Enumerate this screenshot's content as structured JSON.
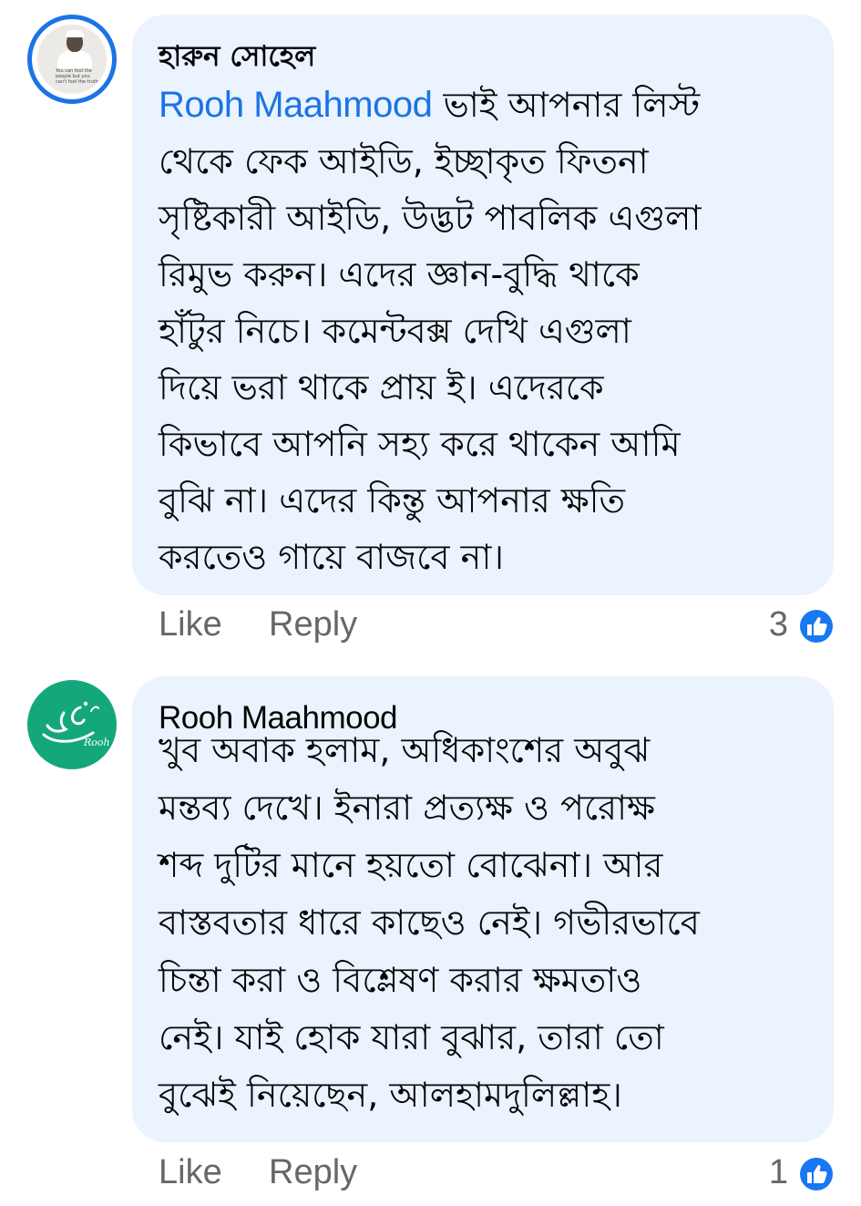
{
  "colors": {
    "bubble_bg": "#eaf3fe",
    "mention": "#1b74e4",
    "action_text": "#65676b",
    "like_badge": "#1877f2",
    "avatar2_bg": "#15a77c"
  },
  "comments": [
    {
      "author": "হারুন সোহেল",
      "avatar_icon": "profile-photo-icon",
      "avatar_text": "You can fool the people but you can't fool the truth",
      "mention": "Rooh Maahmood",
      "text": " ভাই আপনার লিস্ট\nথেকে ফেক আইডি, ইচ্ছাকৃত ফিতনা\nসৃষ্টিকারী আইডি, উদ্ভট পাবলিক এগুলা\nরিমুভ করুন। এদের জ্ঞান-বুদ্ধি থাকে\nহাঁটুর নিচে। কমেন্টবক্স দেখি এগুলা\nদিয়ে ভরা থাকে প্রায় ই। এদেরকে\nকিভাবে আপনি সহ্য করে থাকেন আমি\nবুঝি না। এদের কিন্তু আপনার ক্ষতি\nকরতেও গায়ে বাজবে না।",
      "like_label": "Like",
      "reply_label": "Reply",
      "reaction_count": "3",
      "reaction_icon": "like-icon"
    },
    {
      "author": "Rooh Maahmood",
      "avatar_icon": "rooh-logo-icon",
      "avatar_text": "روح Rooh",
      "text": "খুব অবাক হলাম, অধিকাংশের অবুঝ\nমন্তব্য দেখে। ইনারা প্রত্যক্ষ ও পরোক্ষ\nশব্দ দুটির মানে হয়তো বোঝেনা। আর\nবাস্তবতার ধারে কাছেও নেই। গভীরভাবে\nচিন্তা করা ও বিশ্লেষণ করার ক্ষমতাও\nনেই। যাই হোক যারা বুঝার, তারা তো\nবুঝেই নিয়েছেন, আলহামদুলিল্লাহ।",
      "like_label": "Like",
      "reply_label": "Reply",
      "reaction_count": "1",
      "reaction_icon": "like-icon"
    }
  ]
}
